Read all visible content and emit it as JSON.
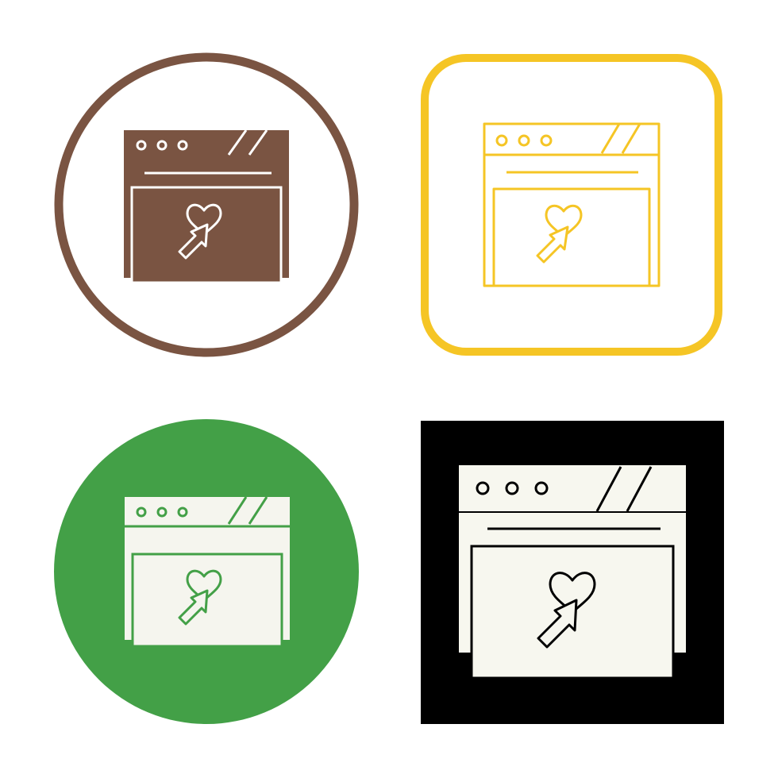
{
  "icon_set": {
    "icon": "browser-window-heart-cursor-icon",
    "variants": [
      {
        "id": "brown-circle",
        "frame": "circle-outline",
        "frame_color": "#7a5442",
        "icon_fill": "#7a5442",
        "detail_color": "#ffffff"
      },
      {
        "id": "yellow-rounded-square",
        "frame": "rounded-square-outline",
        "frame_color": "#f5c525",
        "icon_stroke": "#f5c525"
      },
      {
        "id": "green-circle",
        "frame": "filled-circle",
        "frame_color": "#43a047",
        "icon_fill": "#f5f5ee",
        "detail_color": "#43a047"
      },
      {
        "id": "black-square",
        "frame": "filled-square",
        "frame_color": "#000000",
        "icon_fill": "#f7f7ef",
        "detail_color": "#000000"
      }
    ]
  }
}
